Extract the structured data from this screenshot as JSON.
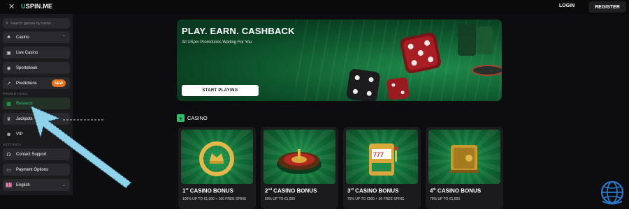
{
  "header": {
    "close_icon": "close-icon",
    "logo_u": "U",
    "logo_rest": "SPIN.ME",
    "login_label": "LOGIN",
    "register_label": "REGISTER"
  },
  "sidebar": {
    "search_placeholder": "Search games by name...",
    "items": [
      {
        "label": "Casino",
        "icon": "clover-icon",
        "chevron": "^"
      },
      {
        "label": "Live Casino",
        "icon": "cards-icon"
      },
      {
        "label": "Sportsbook",
        "icon": "ball-icon"
      },
      {
        "label": "Predictions",
        "icon": "chart-icon",
        "badge": "NEW"
      }
    ],
    "promotions_label": "PROMOTIONS",
    "promo_items": [
      {
        "label": "Rewards",
        "icon": "gift-icon"
      },
      {
        "label": "Jackpots",
        "icon": "trophy-icon"
      },
      {
        "label": "VIP",
        "icon": "crown-icon"
      }
    ],
    "settings_label": "SETTINGS",
    "settings_items": [
      {
        "label": "Contact Support",
        "icon": "headset-icon"
      },
      {
        "label": "Payment Options",
        "icon": "card-icon"
      },
      {
        "label": "English",
        "icon": "flag-icon",
        "chevron": "v"
      }
    ]
  },
  "banner": {
    "title": "PLAY. EARN. CASHBACK",
    "subtitle": "All USpin Promotions Waiting For You",
    "button_label": "START PLAYING"
  },
  "casino": {
    "heading": "CASINO",
    "cards": [
      {
        "ordinal": "1",
        "suffix": "st",
        "title": " CASINO BONUS",
        "desc": "100% UP TO €1,000 + 100 FREE SPINS",
        "icon": "crown-ring-icon"
      },
      {
        "ordinal": "2",
        "suffix": "nd",
        "title": " CASINO BONUS",
        "desc": "50% UP TO €1,000",
        "icon": "roulette-icon"
      },
      {
        "ordinal": "3",
        "suffix": "rd",
        "title": " CASINO BONUS",
        "desc": "75% UP TO €500 + 50 FREE SPINS",
        "icon": "slot-machine-icon"
      },
      {
        "ordinal": "4",
        "suffix": "th",
        "title": " CASINO BONUS",
        "desc": "75% UP TO €1,000",
        "icon": "safe-icon"
      }
    ]
  },
  "colors": {
    "accent": "#27c26a",
    "badge": "#e8721a",
    "arrow": "#8ed3ea"
  }
}
